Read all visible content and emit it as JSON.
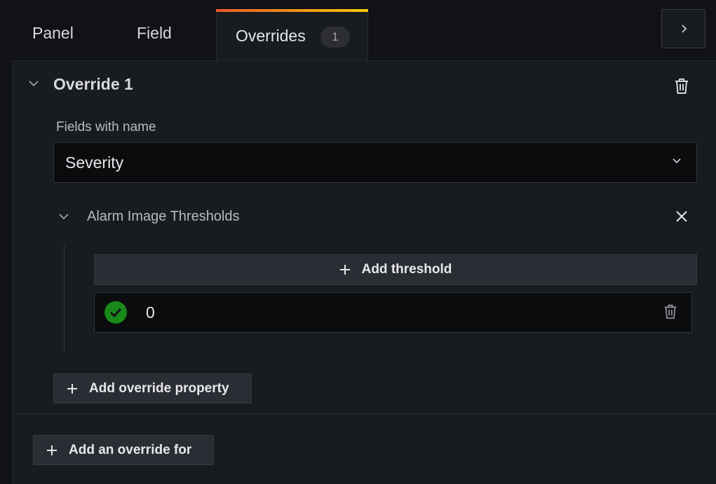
{
  "tabs": [
    {
      "label": "Panel"
    },
    {
      "label": "Field"
    },
    {
      "label": "Overrides",
      "badge": "1",
      "active": true
    }
  ],
  "override": {
    "title": "Override 1",
    "matcher_label": "Fields with name",
    "matcher_value": "Severity",
    "property": {
      "title": "Alarm Image Thresholds",
      "add_threshold_label": "Add threshold",
      "thresholds": [
        {
          "value": "0",
          "color": "#1a8a1a"
        }
      ]
    },
    "add_property_label": "Add override property"
  },
  "add_override_label": "Add an override for",
  "icons": {
    "collapse": "chevron-right-icon",
    "override_toggle": "chevron-down-icon",
    "delete": "trash-icon",
    "close": "close-icon",
    "add": "plus-icon",
    "check": "check-icon"
  },
  "colors": {
    "background": "#111217",
    "panel": "#181b1f",
    "accent_start": "#f05a28",
    "accent_end": "#fbca0a",
    "threshold_green": "#1a8a1a"
  }
}
